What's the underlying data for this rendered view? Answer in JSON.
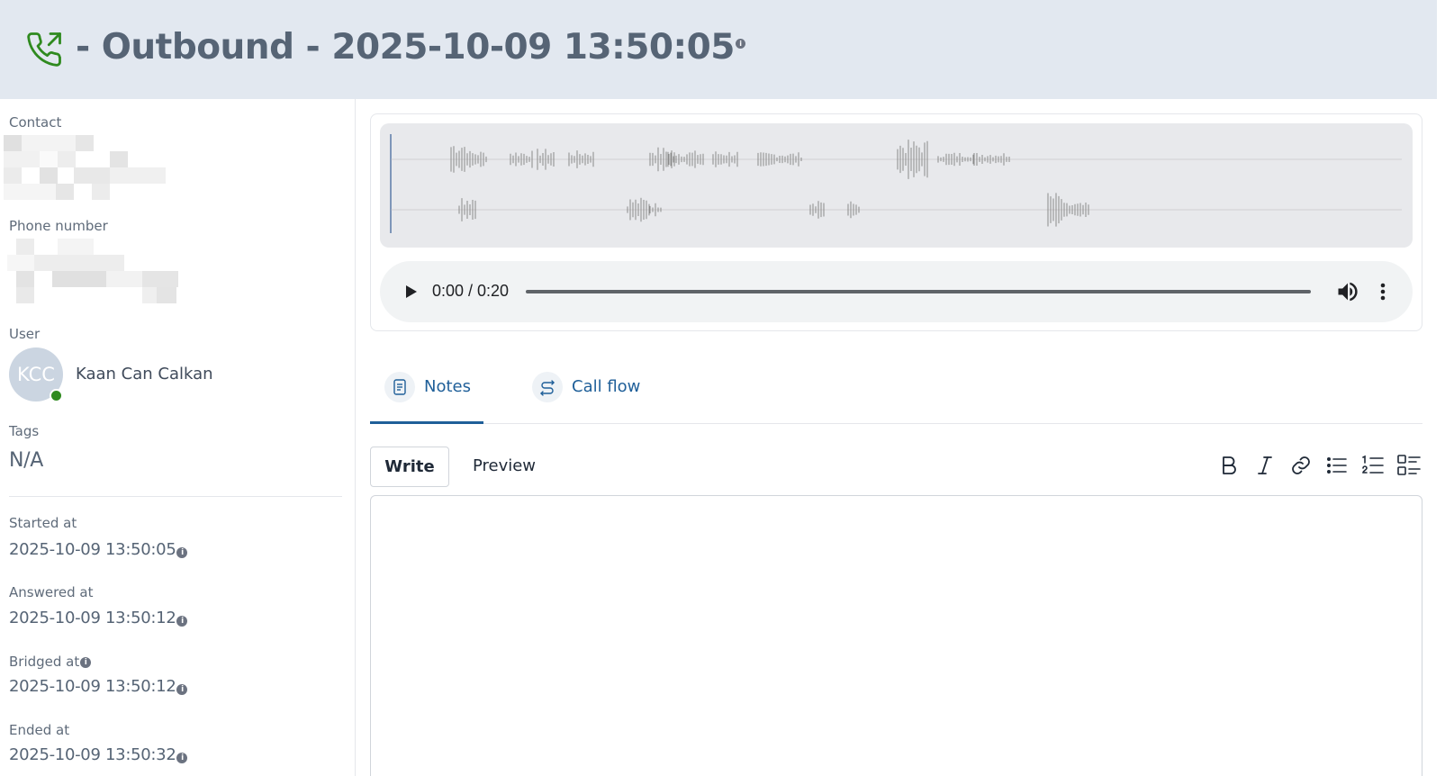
{
  "header": {
    "title": "- Outbound - 2025-10-09 13:50:05",
    "icon": "phone-outgoing-icon"
  },
  "sidebar": {
    "contact_label": "Contact",
    "phone_label": "Phone number",
    "user_label": "User",
    "user": {
      "initials": "KCC",
      "name": "Kaan Can Calkan",
      "status_color": "#2f8a1f"
    },
    "tags_label": "Tags",
    "tags_value": "N/A",
    "started_label": "Started at",
    "started_value": "2025-10-09 13:50:05",
    "answered_label": "Answered at",
    "answered_value": "2025-10-09 13:50:12",
    "bridged_label": "Bridged at",
    "bridged_value": "2025-10-09 13:50:12",
    "ended_label": "Ended at",
    "ended_value": "2025-10-09 13:50:32"
  },
  "player": {
    "time": "0:00 / 0:20"
  },
  "tabs": [
    {
      "label": "Notes",
      "icon": "document-icon",
      "active": true
    },
    {
      "label": "Call flow",
      "icon": "flow-icon",
      "active": false
    }
  ],
  "editor": {
    "write_label": "Write",
    "preview_label": "Preview",
    "toolbar": [
      "bold-icon",
      "italic-icon",
      "link-icon",
      "bullet-list-icon",
      "numbered-list-icon",
      "task-list-icon"
    ]
  },
  "colors": {
    "accent": "#1f5f99",
    "header_bg": "#e2e8f0",
    "phone_icon": "#2f8a1f"
  }
}
